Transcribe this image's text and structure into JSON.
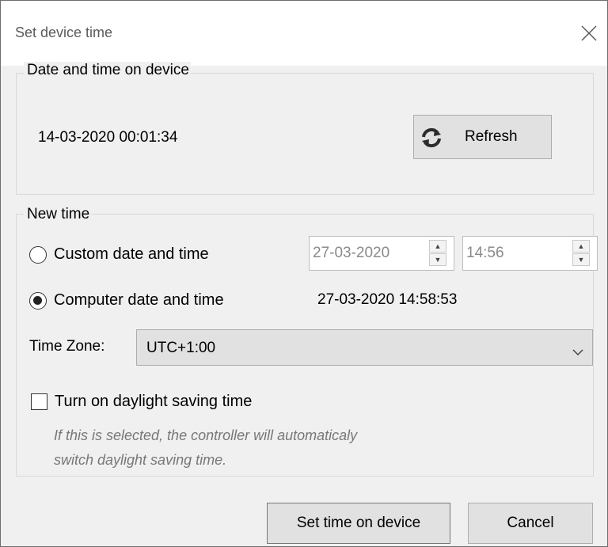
{
  "window": {
    "title": "Set device time"
  },
  "device_group": {
    "legend": "Date and time on device",
    "device_datetime": "14-03-2020 00:01:34",
    "refresh_label": "Refresh"
  },
  "new_time_group": {
    "legend": "New time",
    "custom_label": "Custom date and  time",
    "custom_date": "27-03-2020",
    "custom_time": "14:56",
    "computer_label": "Computer date and time",
    "computer_datetime": "27-03-2020 14:58:53",
    "timezone_label": "Time Zone:",
    "timezone_value": "UTC+1:00",
    "dst_label": "Turn on daylight saving time",
    "hint_line1": "If this is selected, the controller  will automaticaly",
    "hint_line2": " switch daylight  saving time.",
    "selected_option": "computer",
    "dst_checked": false
  },
  "footer": {
    "set_button": "Set time on device",
    "cancel_button": "Cancel"
  },
  "icons": [
    "close-icon",
    "refresh-icon",
    "spin-up-icon",
    "spin-down-icon",
    "chevron-down-icon"
  ]
}
